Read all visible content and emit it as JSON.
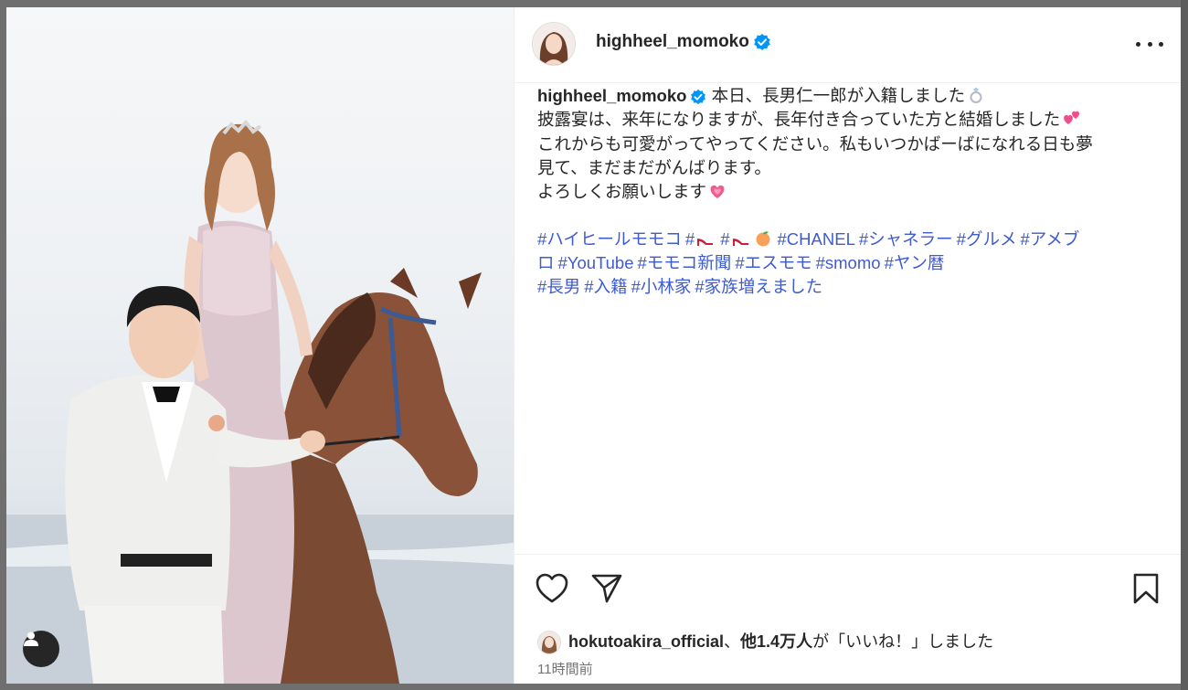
{
  "post": {
    "username": "highheel_momoko",
    "caption_lines": [
      "本日、長男仁一郎が入籍しました",
      "披露宴は、来年になりますが、長年付き合っていた方と結婚しました",
      "これからも可愛がってやってください。私もいつかばーばになれる日も夢",
      "見て、まだまだがんばります。",
      "よろしくお願いします"
    ],
    "hashtag_lines": [
      [
        "#ハイヒールモモコ",
        "#",
        "#",
        "#CHANEL",
        "#シャネラー",
        "#グルメ",
        "#アメブ"
      ],
      [
        "ロ",
        "#YouTube",
        "#モモコ新聞",
        "#エスモモ",
        "#smomo",
        "#ヤン暦"
      ],
      [
        "#長男",
        "#入籍",
        "#小林家",
        "#家族増えました"
      ]
    ],
    "likes": {
      "liker": "hokutoakira_official",
      "separator": "、",
      "others": "他1.4万人",
      "suffix": "が「いいね！」しました"
    },
    "time_ago": "11時間前"
  },
  "icons": {
    "header": [
      "verified-badge-icon",
      "more-options-icon"
    ],
    "actions": [
      "like-heart-icon",
      "share-send-icon",
      "save-bookmark-icon"
    ],
    "caption_emoji": [
      "ring-emoji-icon",
      "two-hearts-emoji-icon",
      "growing-heart-emoji-icon"
    ],
    "tag_emoji": [
      "high-heel-emoji-icon",
      "peach-emoji-icon"
    ],
    "photo": [
      "tagged-user-icon"
    ]
  },
  "colors": {
    "text": "#262626",
    "hashtag": "#3f5bd0",
    "secondary": "#737373",
    "verified": "#0095f6",
    "overlay": "#6f6f6f"
  }
}
